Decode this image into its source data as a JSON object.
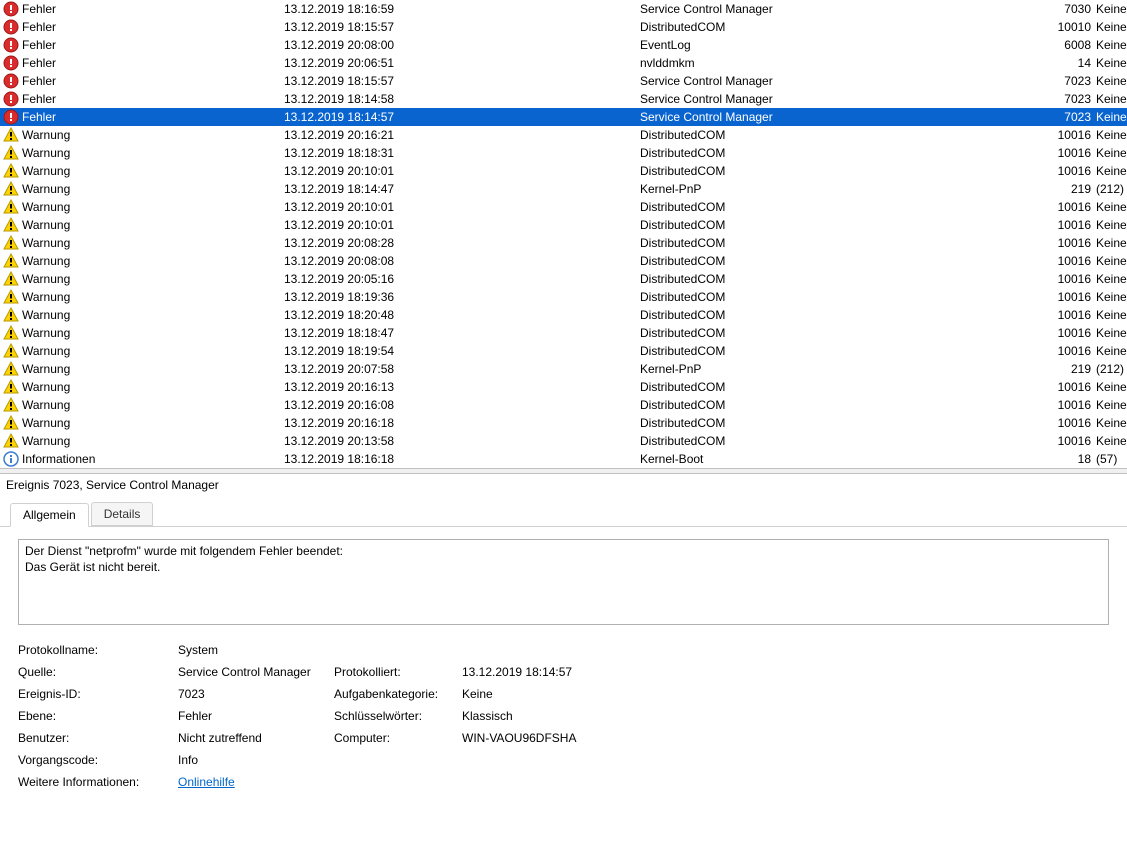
{
  "events": [
    {
      "icon": "error",
      "level": "Fehler",
      "date": "13.12.2019 18:16:59",
      "source": "Service Control Manager",
      "eid": "7030",
      "cat": "Keine"
    },
    {
      "icon": "error",
      "level": "Fehler",
      "date": "13.12.2019 18:15:57",
      "source": "DistributedCOM",
      "eid": "10010",
      "cat": "Keine"
    },
    {
      "icon": "error",
      "level": "Fehler",
      "date": "13.12.2019 20:08:00",
      "source": "EventLog",
      "eid": "6008",
      "cat": "Keine"
    },
    {
      "icon": "error",
      "level": "Fehler",
      "date": "13.12.2019 20:06:51",
      "source": "nvlddmkm",
      "eid": "14",
      "cat": "Keine"
    },
    {
      "icon": "error",
      "level": "Fehler",
      "date": "13.12.2019 18:15:57",
      "source": "Service Control Manager",
      "eid": "7023",
      "cat": "Keine"
    },
    {
      "icon": "error",
      "level": "Fehler",
      "date": "13.12.2019 18:14:58",
      "source": "Service Control Manager",
      "eid": "7023",
      "cat": "Keine"
    },
    {
      "icon": "error",
      "level": "Fehler",
      "date": "13.12.2019 18:14:57",
      "source": "Service Control Manager",
      "eid": "7023",
      "cat": "Keine",
      "selected": true
    },
    {
      "icon": "warn",
      "level": "Warnung",
      "date": "13.12.2019 20:16:21",
      "source": "DistributedCOM",
      "eid": "10016",
      "cat": "Keine"
    },
    {
      "icon": "warn",
      "level": "Warnung",
      "date": "13.12.2019 18:18:31",
      "source": "DistributedCOM",
      "eid": "10016",
      "cat": "Keine"
    },
    {
      "icon": "warn",
      "level": "Warnung",
      "date": "13.12.2019 20:10:01",
      "source": "DistributedCOM",
      "eid": "10016",
      "cat": "Keine"
    },
    {
      "icon": "warn",
      "level": "Warnung",
      "date": "13.12.2019 18:14:47",
      "source": "Kernel-PnP",
      "eid": "219",
      "cat": "(212)"
    },
    {
      "icon": "warn",
      "level": "Warnung",
      "date": "13.12.2019 20:10:01",
      "source": "DistributedCOM",
      "eid": "10016",
      "cat": "Keine"
    },
    {
      "icon": "warn",
      "level": "Warnung",
      "date": "13.12.2019 20:10:01",
      "source": "DistributedCOM",
      "eid": "10016",
      "cat": "Keine"
    },
    {
      "icon": "warn",
      "level": "Warnung",
      "date": "13.12.2019 20:08:28",
      "source": "DistributedCOM",
      "eid": "10016",
      "cat": "Keine"
    },
    {
      "icon": "warn",
      "level": "Warnung",
      "date": "13.12.2019 20:08:08",
      "source": "DistributedCOM",
      "eid": "10016",
      "cat": "Keine"
    },
    {
      "icon": "warn",
      "level": "Warnung",
      "date": "13.12.2019 20:05:16",
      "source": "DistributedCOM",
      "eid": "10016",
      "cat": "Keine"
    },
    {
      "icon": "warn",
      "level": "Warnung",
      "date": "13.12.2019 18:19:36",
      "source": "DistributedCOM",
      "eid": "10016",
      "cat": "Keine"
    },
    {
      "icon": "warn",
      "level": "Warnung",
      "date": "13.12.2019 18:20:48",
      "source": "DistributedCOM",
      "eid": "10016",
      "cat": "Keine"
    },
    {
      "icon": "warn",
      "level": "Warnung",
      "date": "13.12.2019 18:18:47",
      "source": "DistributedCOM",
      "eid": "10016",
      "cat": "Keine"
    },
    {
      "icon": "warn",
      "level": "Warnung",
      "date": "13.12.2019 18:19:54",
      "source": "DistributedCOM",
      "eid": "10016",
      "cat": "Keine"
    },
    {
      "icon": "warn",
      "level": "Warnung",
      "date": "13.12.2019 20:07:58",
      "source": "Kernel-PnP",
      "eid": "219",
      "cat": "(212)"
    },
    {
      "icon": "warn",
      "level": "Warnung",
      "date": "13.12.2019 20:16:13",
      "source": "DistributedCOM",
      "eid": "10016",
      "cat": "Keine"
    },
    {
      "icon": "warn",
      "level": "Warnung",
      "date": "13.12.2019 20:16:08",
      "source": "DistributedCOM",
      "eid": "10016",
      "cat": "Keine"
    },
    {
      "icon": "warn",
      "level": "Warnung",
      "date": "13.12.2019 20:16:18",
      "source": "DistributedCOM",
      "eid": "10016",
      "cat": "Keine"
    },
    {
      "icon": "warn",
      "level": "Warnung",
      "date": "13.12.2019 20:13:58",
      "source": "DistributedCOM",
      "eid": "10016",
      "cat": "Keine"
    },
    {
      "icon": "info",
      "level": "Informationen",
      "date": "13.12.2019 18:16:18",
      "source": "Kernel-Boot",
      "eid": "18",
      "cat": "(57)"
    }
  ],
  "detail": {
    "header": "Ereignis 7023, Service Control Manager",
    "tabs": {
      "general": "Allgemein",
      "details": "Details"
    },
    "message": "Der Dienst \"netprofm\" wurde mit folgendem Fehler beendet:\nDas Gerät ist nicht bereit.",
    "props": {
      "logname_label": "Protokollname:",
      "logname_value": "System",
      "source_label": "Quelle:",
      "source_value": "Service Control Manager",
      "logged_label": "Protokolliert:",
      "logged_value": "13.12.2019 18:14:57",
      "eventid_label": "Ereignis-ID:",
      "eventid_value": "7023",
      "taskcat_label": "Aufgabenkategorie:",
      "taskcat_value": "Keine",
      "level_label": "Ebene:",
      "level_value": "Fehler",
      "keywords_label": "Schlüsselwörter:",
      "keywords_value": "Klassisch",
      "user_label": "Benutzer:",
      "user_value": "Nicht zutreffend",
      "computer_label": "Computer:",
      "computer_value": "WIN-VAOU96DFSHA",
      "opcode_label": "Vorgangscode:",
      "opcode_value": "Info",
      "moreinfo_label": "Weitere Informationen:",
      "moreinfo_link": "Onlinehilfe"
    }
  }
}
